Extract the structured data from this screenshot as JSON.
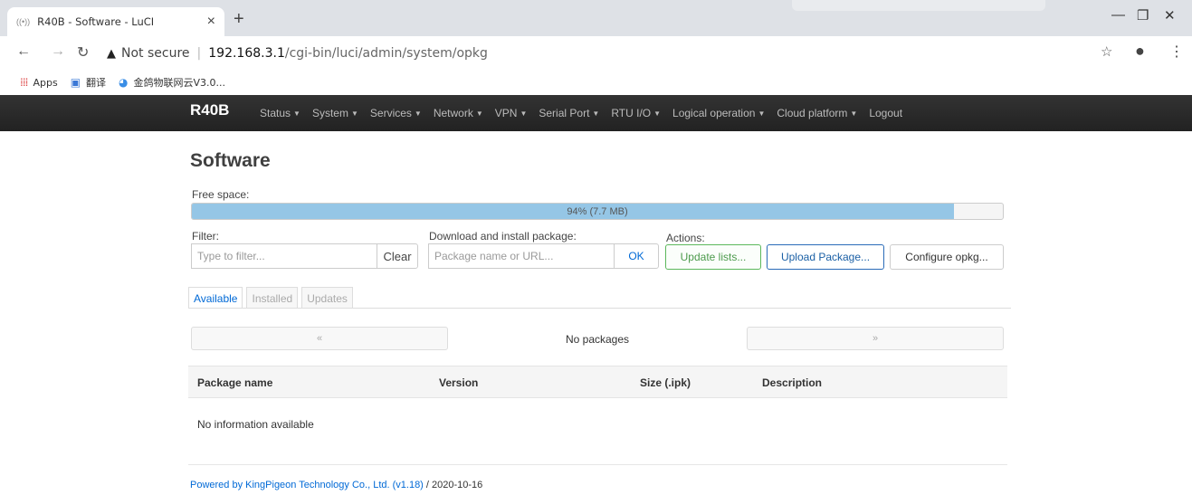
{
  "browser": {
    "tab_title": "R40B - Software - LuCI",
    "tab_close": "×",
    "new_tab": "+",
    "security_label": "Not secure",
    "url_host": "192.168.3.1",
    "url_path": "/cgi-bin/luci/admin/system/opkg",
    "bookmarks": [
      {
        "label": "Apps",
        "icon": "apps-grid-icon"
      },
      {
        "label": "翻译",
        "icon": "translate-icon"
      },
      {
        "label": "金鸽物联网云V3.0...",
        "icon": "cloud-icon"
      }
    ]
  },
  "navbar": {
    "brand": "R40B",
    "items": [
      "Status",
      "System",
      "Services",
      "Network",
      "VPN",
      "Serial Port",
      "RTU I/O",
      "Logical operation",
      "Cloud platform",
      "Logout"
    ]
  },
  "page": {
    "title": "Software",
    "free_space_label": "Free space:",
    "free_space_text": "94% (7.7 MB)",
    "free_space_fraction": 0.94,
    "filter_label": "Filter:",
    "filter_placeholder": "Type to filter...",
    "clear_label": "Clear",
    "download_label": "Download and install package:",
    "download_placeholder": "Package name or URL...",
    "ok_label": "OK",
    "actions_label": "Actions:",
    "update_lists_label": "Update lists...",
    "upload_package_label": "Upload Package...",
    "configure_label": "Configure opkg...",
    "tabs": [
      "Available",
      "Installed",
      "Updates"
    ],
    "pager_prev": "«",
    "pager_next": "»",
    "no_packages": "No packages",
    "columns": [
      "Package name",
      "Version",
      "Size (.ipk)",
      "Description"
    ],
    "no_info": "No information available",
    "footer_link": "Powered by KingPigeon Technology Co., Ltd. (v1.18)",
    "footer_date": " / 2020-10-16"
  },
  "colors": {
    "navbar": "#222222",
    "progress_fill": "#95c6e6",
    "link": "#0069d6",
    "green_button": "#5cb85c",
    "blue_button": "#2a6bb8"
  }
}
